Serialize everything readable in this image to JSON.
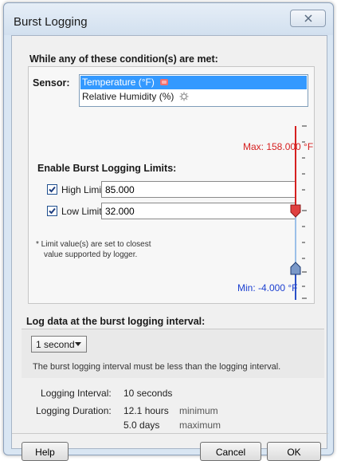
{
  "window": {
    "title": "Burst Logging",
    "close_icon": "close-icon"
  },
  "conditions": {
    "heading": "While any of these condition(s) are met:",
    "sensor_label": "Sensor:",
    "sensors": [
      {
        "label": "Temperature (°F)",
        "selected": true,
        "icon": "temperature-flag-icon"
      },
      {
        "label": "Relative Humidity (%)",
        "selected": false,
        "icon": "gear-icon"
      }
    ],
    "max_text": "Max: 158.000 °F",
    "min_text": "Min: -4.000 °F",
    "enable_limits_heading": "Enable Burst Logging Limits:",
    "high_limit": {
      "label": "High Limit",
      "checked": true,
      "value": "85.000"
    },
    "low_limit": {
      "label": "Low Limit",
      "checked": true,
      "value": "32.000"
    },
    "note_line1": "* Limit value(s) are set to closest",
    "note_line2": "value supported by logger.",
    "slider": {
      "max_color": "#d62020",
      "min_color": "#2a50c8"
    }
  },
  "interval": {
    "heading": "Log data at the burst logging interval:",
    "selected": "1 second",
    "note": "The burst logging interval must be less than the logging interval."
  },
  "stats": {
    "logging_interval_label": "Logging Interval:",
    "logging_interval_value": "10 seconds",
    "logging_duration_label": "Logging Duration:",
    "duration_min_value": "12.1 hours",
    "duration_min_qualifier": "minimum",
    "duration_max_value": "5.0 days",
    "duration_max_qualifier": "maximum"
  },
  "buttons": {
    "help": "Help",
    "cancel": "Cancel",
    "ok": "OK"
  }
}
